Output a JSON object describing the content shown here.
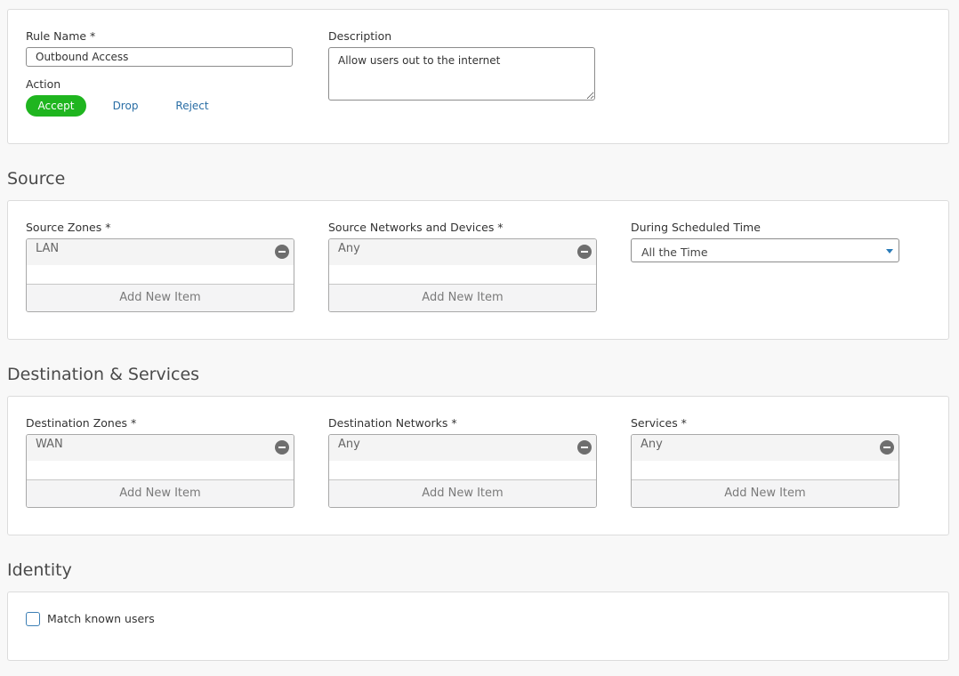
{
  "rule": {
    "name_label": "Rule Name *",
    "name_value": "Outbound Access",
    "description_label": "Description",
    "description_value": "Allow users out to the internet",
    "action_label": "Action",
    "actions": {
      "accept": "Accept",
      "drop": "Drop",
      "reject": "Reject"
    }
  },
  "source": {
    "title": "Source",
    "zones_label": "Source Zones *",
    "zones_item": "LAN",
    "networks_label": "Source Networks and Devices *",
    "networks_item": "Any",
    "schedule_label": "During Scheduled Time",
    "schedule_value": "All the Time"
  },
  "destination": {
    "title": "Destination & Services",
    "zones_label": "Destination Zones *",
    "zones_item": "WAN",
    "networks_label": "Destination Networks *",
    "networks_item": "Any",
    "services_label": "Services *",
    "services_item": "Any"
  },
  "identity": {
    "title": "Identity",
    "match_label": "Match known users"
  },
  "common": {
    "add_new_item": "Add New Item"
  },
  "colors": {
    "accent_green": "#1fb51f",
    "link_blue": "#2a6ea5"
  }
}
